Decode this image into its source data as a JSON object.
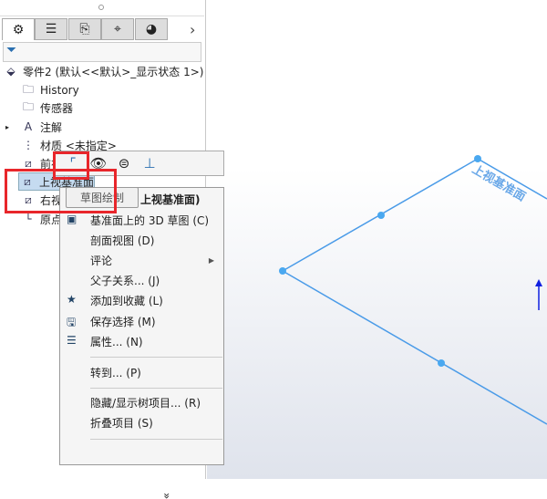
{
  "tabs": [
    {
      "icon": "feature-manager-icon"
    },
    {
      "icon": "property-manager-icon"
    },
    {
      "icon": "configuration-manager-icon"
    },
    {
      "icon": "dimxpert-icon"
    },
    {
      "icon": "display-manager-icon"
    }
  ],
  "tabs_more": "›",
  "tree": {
    "root": "零件2  (默认<<默认>_显示状态 1>)",
    "items": [
      "History",
      "传感器",
      "注解",
      "材质 <未指定>",
      "前视基准面",
      "上视基准面",
      "右视基准面",
      "原点"
    ]
  },
  "toolbar": {
    "items": [
      "sketch-icon",
      "hide-show-icon",
      "zoom-to-selection-icon",
      "normal-to-icon"
    ]
  },
  "tooltip": "草图绘制",
  "menu": {
    "header": "上视基准面)",
    "items": [
      "基准面上的 3D 草图 (C)",
      "剖面视图 (D)",
      "评论",
      "父子关系... (J)",
      "添加到收藏 (L)",
      "保存选择 (M)",
      "属性... (N)",
      "转到... (P)",
      "隐藏/显示树项目... (R)",
      "折叠项目 (S)"
    ],
    "more": "»"
  },
  "graphics": {
    "plane_label": "上视基准面",
    "plane_color": "#4a9be8"
  },
  "colors": {
    "highlight": "#e8262b",
    "selection": "#c5dbf0"
  }
}
